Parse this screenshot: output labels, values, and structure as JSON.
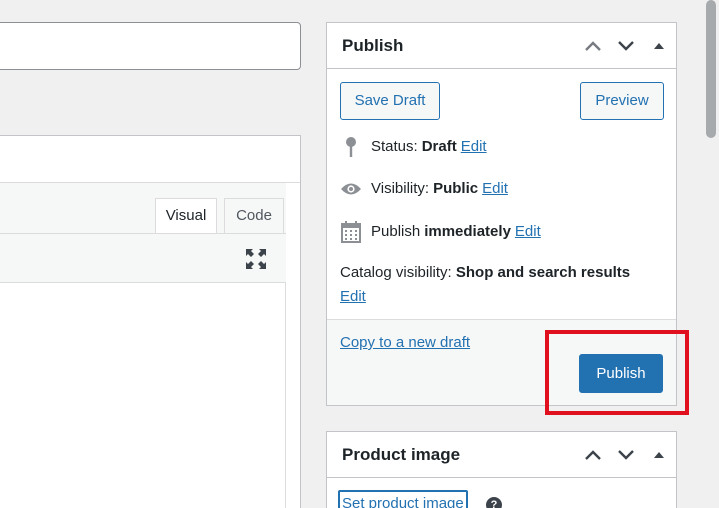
{
  "editor": {
    "tabs": [
      {
        "label": "Visual"
      },
      {
        "label": "Code"
      }
    ]
  },
  "publish": {
    "title": "Publish",
    "save_draft": "Save Draft",
    "preview": "Preview",
    "status_label": "Status:",
    "status_value": "Draft",
    "visibility_label": "Visibility:",
    "visibility_value": "Public",
    "publish_label": "Publish",
    "publish_value": "immediately",
    "edit": "Edit",
    "catalog_label": "Catalog visibility:",
    "catalog_value": "Shop and search results",
    "copy_draft": "Copy to a new draft",
    "publish_button": "Publish"
  },
  "product_image": {
    "title": "Product image",
    "set_link": "Set product image",
    "help": "?"
  },
  "colors": {
    "accent": "#2271b1",
    "highlight": "#e0101e"
  }
}
